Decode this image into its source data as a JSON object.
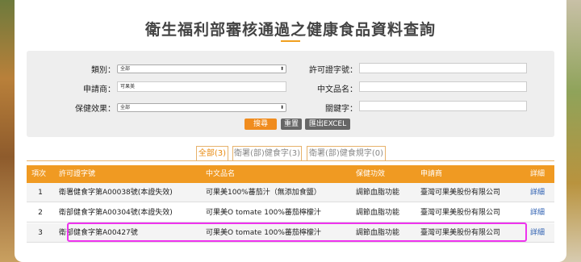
{
  "page_title": "衛生福利部審核通過之健康食品資料查詢",
  "search": {
    "category_label": "類別：",
    "category_value": "全部",
    "permit_label": "許可證字號：",
    "permit_value": "",
    "applicant_label": "申請商：",
    "applicant_value": "可果美",
    "name_label": "中文品名：",
    "name_value": "",
    "effect_label": "保健效果：",
    "effect_value": "全部",
    "keyword_label": "關鍵字：",
    "keyword_value": "",
    "search_btn": "搜尋",
    "reset_btn": "重置",
    "excel_btn": "匯出EXCEL"
  },
  "tabs": [
    {
      "label": "全部(3)",
      "active": true
    },
    {
      "label": "衛署(部)健食字(3)",
      "active": false
    },
    {
      "label": "衛署(部)健食規字(0)",
      "active": false
    }
  ],
  "table": {
    "headers": [
      "項次",
      "許可證字號",
      "中文品名",
      "保健功效",
      "申請商",
      "詳細"
    ],
    "rows": [
      [
        "1",
        "衛署健食字第A00038號(本證失效)",
        "可果美100%蕃茄汁（無添加食鹽）",
        "調節血脂功能",
        "臺灣可果美股份有限公司",
        "詳細"
      ],
      [
        "2",
        "衛部健食字第A00304號(本證失效)",
        "可果美O tomate 100%蕃茄檸檬汁",
        "調節血脂功能",
        "臺灣可果美股份有限公司",
        "詳細"
      ],
      [
        "3",
        "衛部健食字第A00427號",
        "可果美O tomate 100%蕃茄檸檬汁",
        "調節血脂功能",
        "臺灣可果美股份有限公司",
        "詳細"
      ]
    ]
  },
  "colors": {
    "accent": "#f09a22",
    "highlight": "#ee33ee",
    "link": "#2a5db0"
  }
}
